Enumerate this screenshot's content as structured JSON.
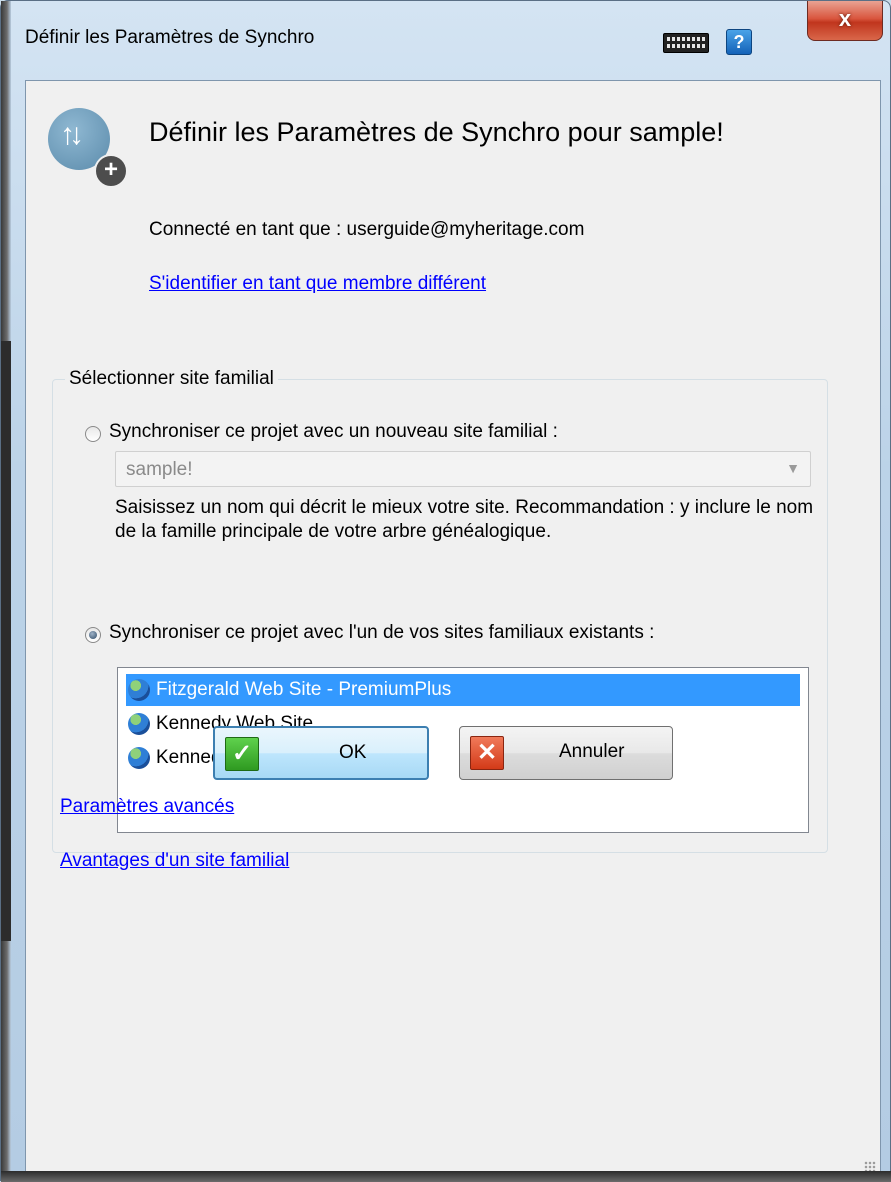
{
  "window": {
    "title": "Définir les Paramètres de Synchro",
    "help_label": "?",
    "close_label": "x"
  },
  "header": {
    "heading": "Définir les Paramètres de Synchro pour sample!",
    "connected": "Connecté en tant que : userguide@myheritage.com",
    "switch_link": "S'identifier en tant que membre différent"
  },
  "site_group": {
    "legend": "Sélectionner site familial",
    "option_new": {
      "label": "Synchroniser ce projet avec un nouveau site familial :",
      "checked": false,
      "name_value": "sample!",
      "hint": "Saisissez un nom qui décrit le mieux votre site. Recommandation : y inclure le nom de la famille principale de votre arbre généalogique."
    },
    "option_existing": {
      "label": "Synchroniser ce projet avec l'un de vos sites familiaux existants :",
      "checked": true,
      "sites": [
        {
          "name": "Fitzgerald Web Site - PremiumPlus",
          "selected": true,
          "icon": "globe-icon"
        },
        {
          "name": "Kennedy Web Site",
          "selected": false,
          "icon": "globe-icon"
        },
        {
          "name": "Kennedy Fitzgerald Web Site",
          "selected": false,
          "icon": "globe-icon"
        }
      ]
    }
  },
  "links": {
    "advanced": "Paramètres avancés",
    "benefits": "Avantages d'un site familial"
  },
  "buttons": {
    "ok": "OK",
    "cancel": "Annuler"
  },
  "colors": {
    "selection": "#3399ff",
    "link": "#0000ff",
    "ok_icon": "#2f9a21",
    "cancel_icon": "#d33a18"
  }
}
